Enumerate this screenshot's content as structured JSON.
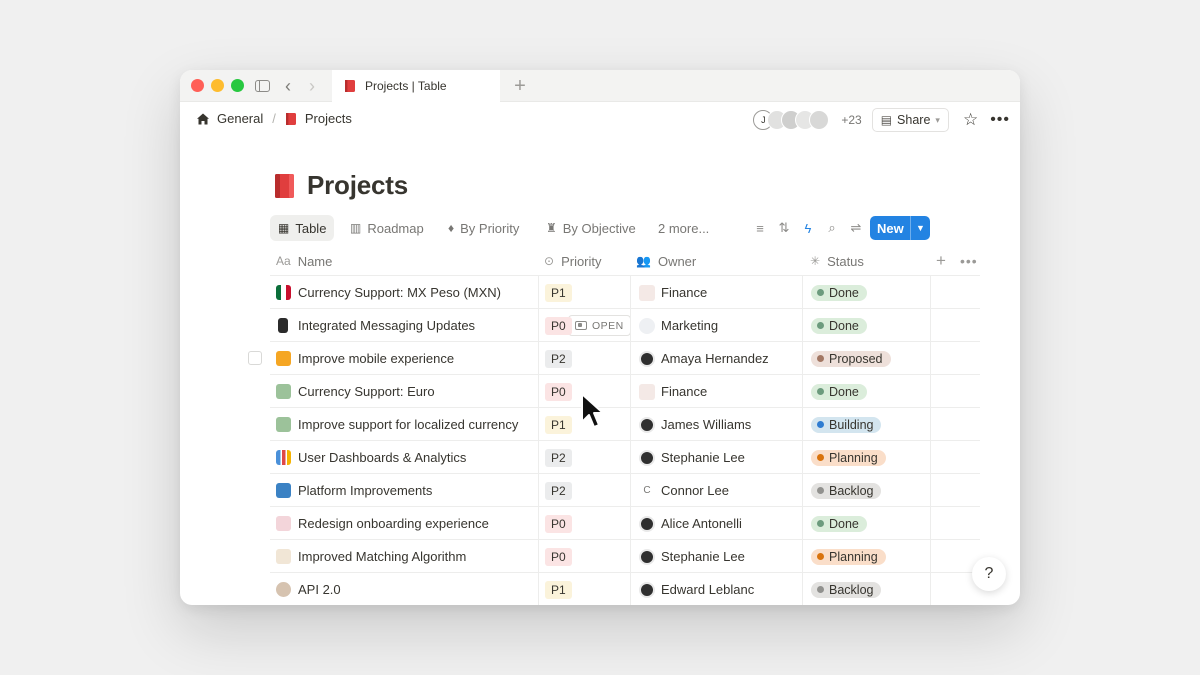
{
  "tab": {
    "title": "Projects | Table"
  },
  "breadcrumb": {
    "items": [
      "General",
      "Projects"
    ],
    "separator": "/"
  },
  "header": {
    "avatar_initial": "J",
    "extra_count": "+23",
    "share_label": "Share"
  },
  "page": {
    "title": "Projects"
  },
  "views": [
    "Table",
    "Roadmap",
    "By Priority",
    "By Objective",
    "2 more..."
  ],
  "new_button": "New",
  "columns": {
    "name": "Name",
    "priority": "Priority",
    "owner": "Owner",
    "status": "Status",
    "name_icon": "Aa"
  },
  "row_hover": {
    "open_label": "OPEN"
  },
  "colors": {
    "accent": "#2383e2",
    "p0_bg": "#fbe4e4",
    "p1_bg": "#fbf3db",
    "p2_bg": "#ebeced",
    "done_bg": "#dbeddb",
    "done_dot": "#6c9b7d",
    "proposed_bg": "#eee0da",
    "proposed_dot": "#a27763",
    "building_bg": "#d3e5ef",
    "building_dot": "#2e7cd1",
    "planning_bg": "#fadec9",
    "planning_dot": "#d9730d",
    "backlog_bg": "#e3e2e0",
    "backlog_dot": "#91918e"
  },
  "rows": [
    {
      "icon": "mexico-flag-icon",
      "name": "Currency Support: MX Peso (MXN)",
      "priority": "P1",
      "owner": "Finance",
      "owner_icon": "tag-icon",
      "status": "Done",
      "status_key": "done"
    },
    {
      "icon": "phone-icon",
      "name": "Integrated Messaging Updates",
      "priority": "P0",
      "owner": "Marketing",
      "owner_icon": "cloud-icon",
      "status": "Done",
      "status_key": "done"
    },
    {
      "icon": "mobile-app-icon",
      "name": "Improve mobile experience",
      "priority": "P2",
      "owner": "Amaya Hernandez",
      "owner_icon": "avatar-icon",
      "status": "Proposed",
      "status_key": "proposed"
    },
    {
      "icon": "euro-banknote-icon",
      "name": "Currency Support: Euro",
      "priority": "P0",
      "owner": "Finance",
      "owner_icon": "tag-icon",
      "status": "Done",
      "status_key": "done"
    },
    {
      "icon": "euro-banknote-icon",
      "name": "Improve support for localized currency",
      "priority": "P1",
      "owner": "James Williams",
      "owner_icon": "avatar-icon",
      "status": "Building",
      "status_key": "building"
    },
    {
      "icon": "bar-chart-icon",
      "name": "User Dashboards & Analytics",
      "priority": "P2",
      "owner": "Stephanie Lee",
      "owner_icon": "avatar-icon",
      "status": "Planning",
      "status_key": "planning"
    },
    {
      "icon": "arrows-icon",
      "name": "Platform Improvements",
      "priority": "P2",
      "owner": "Connor Lee",
      "owner_icon": "initial-c-icon",
      "owner_initial": "C",
      "status": "Backlog",
      "status_key": "backlog"
    },
    {
      "icon": "heart-letter-icon",
      "name": "Redesign onboarding experience",
      "priority": "P0",
      "owner": "Alice Antonelli",
      "owner_icon": "avatar-icon",
      "status": "Done",
      "status_key": "done"
    },
    {
      "icon": "sparkle-icon",
      "name": "Improved Matching Algorithm",
      "priority": "P0",
      "owner": "Stephanie Lee",
      "owner_icon": "avatar-icon",
      "status": "Planning",
      "status_key": "planning"
    },
    {
      "icon": "technologist-icon",
      "name": "API 2.0",
      "priority": "P1",
      "owner": "Edward Leblanc",
      "owner_icon": "avatar-icon",
      "status": "Backlog",
      "status_key": "backlog"
    }
  ]
}
